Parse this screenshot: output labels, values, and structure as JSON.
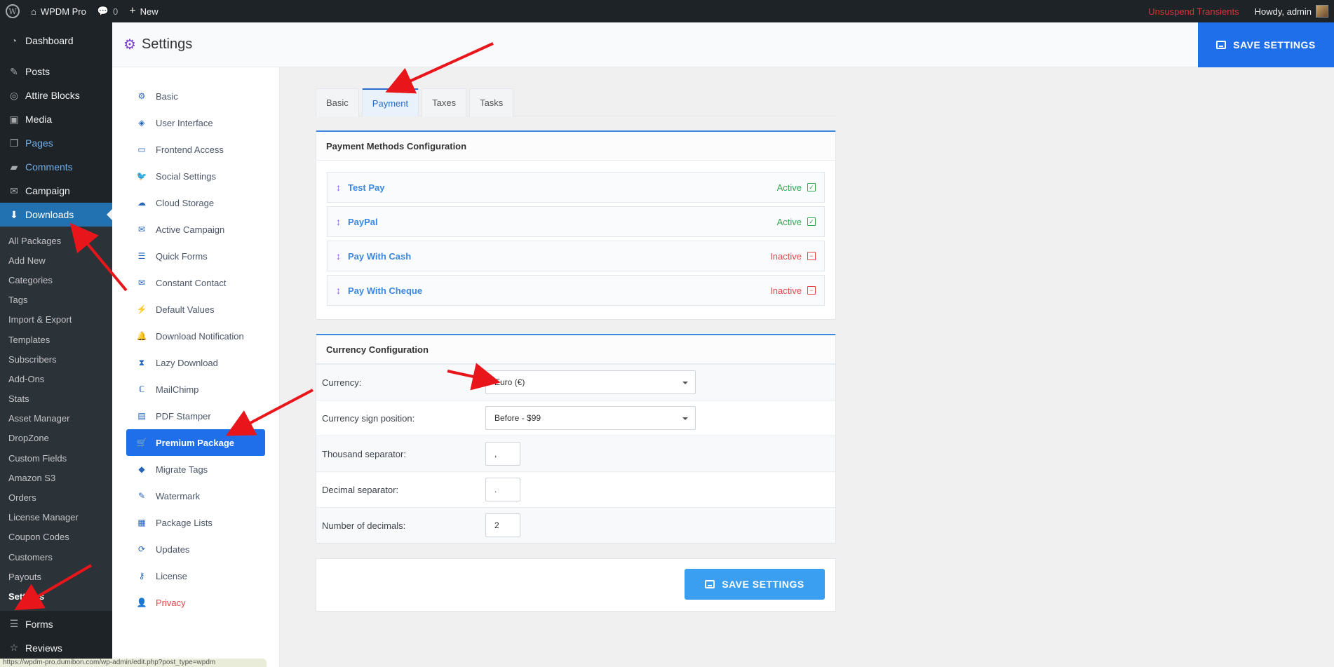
{
  "adminbar": {
    "site_name": "WPDM Pro",
    "comments_count": "0",
    "new_label": "New",
    "unsuspend_label": "Unsuspend Transients",
    "howdy_label": "Howdy, admin"
  },
  "menu": {
    "dashboard": "Dashboard",
    "posts": "Posts",
    "attire_blocks": "Attire Blocks",
    "media": "Media",
    "pages": "Pages",
    "comments": "Comments",
    "campaign": "Campaign",
    "downloads": "Downloads",
    "forms": "Forms",
    "reviews": "Reviews",
    "downloads_sub": [
      "All Packages",
      "Add New",
      "Categories",
      "Tags",
      "Import & Export",
      "Templates",
      "Subscribers",
      "Add-Ons",
      "Stats",
      "Asset Manager",
      "DropZone",
      "Custom Fields",
      "Amazon S3",
      "Orders",
      "License Manager",
      "Coupon Codes",
      "Customers",
      "Payouts",
      "Settings"
    ]
  },
  "header": {
    "title": "Settings",
    "save_label": "SAVE SETTINGS"
  },
  "settings_nav": [
    {
      "label": "Basic",
      "icon": "gear-icon"
    },
    {
      "label": "User Interface",
      "icon": "paint-bucket-icon"
    },
    {
      "label": "Frontend Access",
      "icon": "desktop-icon"
    },
    {
      "label": "Social Settings",
      "icon": "twitter-icon"
    },
    {
      "label": "Cloud Storage",
      "icon": "cloud-icon"
    },
    {
      "label": "Active Campaign",
      "icon": "envelope-icon"
    },
    {
      "label": "Quick Forms",
      "icon": "list-icon"
    },
    {
      "label": "Constant Contact",
      "icon": "envelope-icon"
    },
    {
      "label": "Default Values",
      "icon": "bolt-icon"
    },
    {
      "label": "Download Notification",
      "icon": "bell-icon"
    },
    {
      "label": "Lazy Download",
      "icon": "hourglass-icon"
    },
    {
      "label": "MailChimp",
      "icon": "mailchimp-icon"
    },
    {
      "label": "PDF Stamper",
      "icon": "pdf-icon"
    },
    {
      "label": "Premium Package",
      "icon": "cart-icon"
    },
    {
      "label": "Migrate Tags",
      "icon": "tags-icon"
    },
    {
      "label": "Watermark",
      "icon": "pen-icon"
    },
    {
      "label": "Package Lists",
      "icon": "list-alt-icon"
    },
    {
      "label": "Updates",
      "icon": "sync-icon"
    },
    {
      "label": "License",
      "icon": "key-icon"
    },
    {
      "label": "Privacy",
      "icon": "user-lock-icon"
    }
  ],
  "tabs": [
    "Basic",
    "Payment",
    "Taxes",
    "Tasks"
  ],
  "payment_methods": {
    "title": "Payment Methods Configuration",
    "items": [
      {
        "name": "Test Pay",
        "status": "Active"
      },
      {
        "name": "PayPal",
        "status": "Active"
      },
      {
        "name": "Pay With Cash",
        "status": "Inactive"
      },
      {
        "name": "Pay With Cheque",
        "status": "Inactive"
      }
    ]
  },
  "currency": {
    "title": "Currency Configuration",
    "currency_label": "Currency:",
    "currency_value": "Euro (€)",
    "sign_position_label": "Currency sign position:",
    "sign_position_value": "Before - $99",
    "thousand_label": "Thousand separator:",
    "thousand_value": ",",
    "decimal_label": "Decimal separator:",
    "decimal_value": ".",
    "decimals_label": "Number of decimals:",
    "decimals_value": "2"
  },
  "footer": {
    "save_label": "SAVE SETTINGS",
    "status_url": "https://wpdm-pro.dumibon.com/wp-admin/edit.php?post_type=wpdm"
  },
  "colors": {
    "primary": "#1f6feb",
    "active": "#31a853",
    "inactive": "#e2464b",
    "annotation_arrow": "#e8161b"
  }
}
